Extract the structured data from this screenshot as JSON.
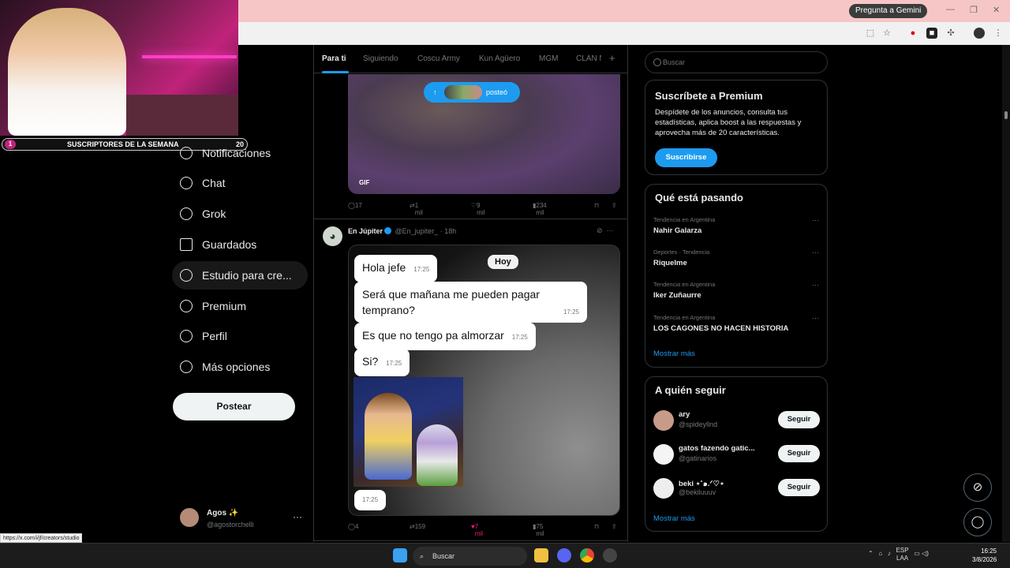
{
  "browser": {
    "gemini_label": "Pregunta a Gemini",
    "status_url": "https://x.com/i/jf/creators/studio"
  },
  "overlay": {
    "subs_count_left": "1",
    "subs_label": "SUSCRIPTORES DE LA SEMANA",
    "subs_count_right": "20"
  },
  "nav": {
    "items": [
      {
        "label": "Notificaciones",
        "icon": "bell-icon"
      },
      {
        "label": "Chat",
        "icon": "chat-icon"
      },
      {
        "label": "Grok",
        "icon": "grok-icon"
      },
      {
        "label": "Guardados",
        "icon": "bookmark-icon"
      },
      {
        "label": "Estudio para cre...",
        "icon": "rocket-icon"
      },
      {
        "label": "Premium",
        "icon": "verified-icon"
      },
      {
        "label": "Perfil",
        "icon": "person-icon"
      },
      {
        "label": "Más opciones",
        "icon": "more-icon"
      }
    ],
    "post_label": "Postear"
  },
  "account": {
    "name": "Agos ✨",
    "handle": "@agostorchelli"
  },
  "tabs": [
    "Para ti",
    "Siguiendo",
    "Coscu Army",
    "Kun Agüero",
    "MGM",
    "CLAN N"
  ],
  "feed": {
    "posted_label": "posteó",
    "post1": {
      "gif_label": "GIF",
      "replies": "17",
      "reposts": "1 mil",
      "likes": "9 mil",
      "views": "234 mil"
    },
    "post2": {
      "name": "En Júpiter",
      "handle": "@En_jupiter_",
      "time": "· 18h",
      "day_label": "Hoy",
      "messages": [
        {
          "text": "Hola jefe",
          "time": "17:25"
        },
        {
          "text": "Será que mañana me pueden pagar temprano?",
          "time": "17:25"
        },
        {
          "text": "Es que no tengo pa almorzar",
          "time": "17:25"
        },
        {
          "text": "Si?",
          "time": "17:25"
        }
      ],
      "sticker_time": "17:25",
      "replies": "4",
      "reposts": "159",
      "likes": "7 mil",
      "views": "75 mil"
    }
  },
  "right": {
    "search_placeholder": "Buscar",
    "premium": {
      "title": "Suscríbete a Premium",
      "text": "Despídete de los anuncios, consulta tus estadísticas, aplica boost a las respuestas y aprovecha más de 20 características.",
      "button": "Suscribirse"
    },
    "trends": {
      "title": "Qué está pasando",
      "items": [
        {
          "context": "Tendencia en Argentina",
          "name": "Nahir Galarza"
        },
        {
          "context": "Deportes · Tendencia",
          "name": "Riquelme"
        },
        {
          "context": "Tendencia en Argentina",
          "name": "Iker Zuñaurre"
        },
        {
          "context": "Tendencia en Argentina",
          "name": "LOS CAGONES NO HACEN HISTORIA"
        }
      ],
      "more": "Mostrar más"
    },
    "follow": {
      "title": "A quién seguir",
      "items": [
        {
          "name": "ary",
          "handle": "@spideyllnd"
        },
        {
          "name": "gatos fazendo gatic...",
          "handle": "@gatinarios"
        },
        {
          "name": "beki ⋆˚๑.ᐟ♡⋆",
          "handle": "@bekiluuuv"
        }
      ],
      "follow_label": "Seguir",
      "more": "Mostrar más"
    }
  },
  "taskbar": {
    "search": "Buscar",
    "lang": "ESP",
    "lang2": "LAA",
    "time": "16:25",
    "date": "3/8/2026"
  }
}
